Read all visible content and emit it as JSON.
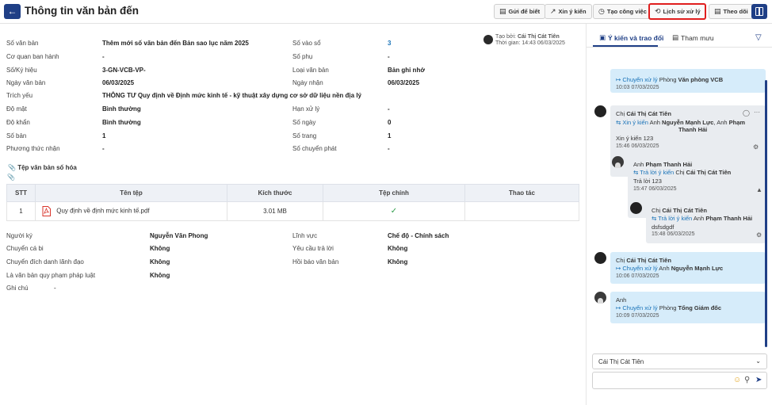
{
  "header": {
    "title": "Thông tin văn bản đến",
    "buttons": {
      "send_info": "Gửi để biết",
      "ask_opinion": "Xin ý kiến",
      "create_task": "Tạo công việc",
      "history": "Lịch sử xử lý",
      "follow": "Theo dõi"
    }
  },
  "creator": {
    "created_by_label": "Tạo bởi:",
    "created_by": "Cái Thị Cát Tiên",
    "time_label": "Thời gian:",
    "time": "14:43 06/03/2025"
  },
  "fields": {
    "so_van_ban": {
      "label": "Số văn bản",
      "value": "Thêm mới số văn bản đến Bản sao lục năm 2025"
    },
    "so_vao_so": {
      "label": "Số vào sổ",
      "value": "3"
    },
    "co_quan": {
      "label": "Cơ quan ban hành",
      "value": "-"
    },
    "so_phu": {
      "label": "Số phụ",
      "value": "-"
    },
    "so_ky_hieu": {
      "label": "Số/Ký hiệu",
      "value": "3-GN-VCB-VP-"
    },
    "loai_van_ban": {
      "label": "Loại văn bản",
      "value": "Bản ghi nhớ"
    },
    "ngay_van_ban": {
      "label": "Ngày văn bản",
      "value": "06/03/2025"
    },
    "ngay_nhan": {
      "label": "Ngày nhận",
      "value": "06/03/2025"
    },
    "trich_yeu": {
      "label": "Trích yếu",
      "value": "THÔNG TƯ Quy định về Định mức kinh tế - kỹ thuật xây dựng cơ sở dữ liệu nền địa lý"
    },
    "do_mat": {
      "label": "Độ mật",
      "value": "Bình thường"
    },
    "han_xu_ly": {
      "label": "Hạn xử lý",
      "value": "-"
    },
    "do_khan": {
      "label": "Độ khẩn",
      "value": "Bình thường"
    },
    "so_ngay": {
      "label": "Số ngày",
      "value": "0"
    },
    "so_ban": {
      "label": "Số bản",
      "value": "1"
    },
    "so_trang": {
      "label": "Số trang",
      "value": "1"
    },
    "phuong_thuc": {
      "label": "Phương thức nhận",
      "value": "-"
    },
    "so_chuyen_phat": {
      "label": "Số chuyển phát",
      "value": "-"
    },
    "nguoi_ky": {
      "label": "Người ký",
      "value": "Nguyễn Văn Phong"
    },
    "linh_vuc": {
      "label": "Lĩnh vực",
      "value": "Chế độ - Chính sách"
    },
    "chuyen_ca_bi": {
      "label": "Chuyển cá bi",
      "value": "Không"
    },
    "yeu_cau_tra_loi": {
      "label": "Yêu cầu trả lời",
      "value": "Không"
    },
    "chuyen_dich_danh": {
      "label": "Chuyển đích danh lãnh đạo",
      "value": "Không"
    },
    "hoi_bao": {
      "label": "Hồi báo văn bản",
      "value": "Không"
    },
    "qppl": {
      "label": "Là văn bản quy phạm pháp luật",
      "value": "Không"
    },
    "ghi_chu": {
      "label": "Ghi chú",
      "value": "-"
    }
  },
  "files": {
    "section_title": "Tệp văn bản số hóa",
    "columns": [
      "STT",
      "Tên tệp",
      "Kích thước",
      "Tệp chính",
      "Thao tác"
    ],
    "rows": [
      {
        "stt": "1",
        "name": "Quy định về định mức kinh tế.pdf",
        "size": "3.01 MB",
        "main": "✓"
      }
    ]
  },
  "right_panel": {
    "tabs": [
      "Ý kiến và trao đổi",
      "Tham mưu"
    ],
    "comments": [
      {
        "action": "Chuyển xử lý",
        "target_prefix": "Phòng",
        "target": "Văn phòng VCB",
        "time": "10:03 07/03/2025"
      },
      {
        "sender_prefix": "Chị",
        "sender": "Cái Thị Cát Tiên",
        "action": "Xin ý kiến",
        "to_prefix": "Anh",
        "to1": "Nguyễn Mạnh Lực",
        "to_prefix2": ", Anh",
        "to2": "Phạm",
        "to2b": "Thanh Hải",
        "content": "Xin ý kiến 123",
        "time": "15:46 06/03/2025"
      },
      {
        "sender_prefix": "Anh",
        "sender": "Phạm Thanh Hải",
        "action": "Trả lời ý kiến",
        "to_prefix": "Chị",
        "to": "Cái Thị Cát Tiên",
        "content": "Trả lời 123",
        "time": "15:47 06/03/2025"
      },
      {
        "sender_prefix": "Chị",
        "sender": "Cái Thị Cát Tiên",
        "action": "Trả lời ý kiến",
        "to_prefix": "Anh",
        "to": "Phạm Thanh Hải",
        "content": "dsfsdgdf",
        "time": "15:48 06/03/2025"
      },
      {
        "sender_prefix": "Chị",
        "sender": "Cái Thị Cát Tiên",
        "action": "Chuyển xử lý",
        "to_prefix": "Anh",
        "to": "Nguyễn Mạnh Lực",
        "time": "10:06 07/03/2025"
      },
      {
        "sender_prefix": "Anh",
        "sender": "",
        "action": "Chuyển xử lý",
        "to_prefix": "Phòng",
        "to": "Tổng Giám đốc",
        "time": "10:09 07/03/2025"
      }
    ],
    "selected_user": "Cái Thị Cát Tiên",
    "input_placeholder": ""
  }
}
